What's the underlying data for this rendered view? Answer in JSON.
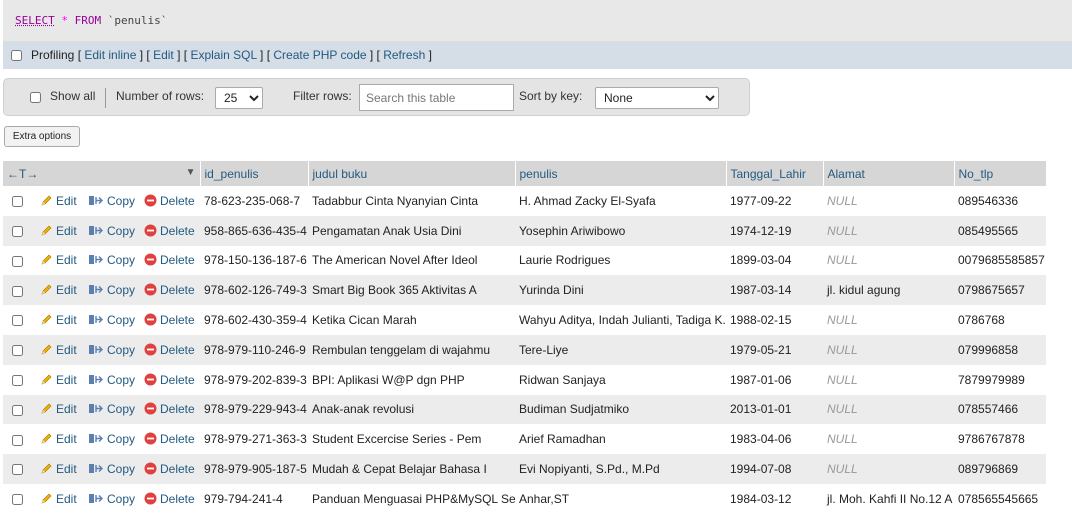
{
  "query": {
    "kw1": "SELECT",
    "star": "*",
    "kw2": "FROM",
    "table": "`penulis`"
  },
  "profiling": {
    "label": "Profiling",
    "links": [
      "Edit inline",
      "Edit",
      "Explain SQL",
      "Create PHP code",
      "Refresh"
    ]
  },
  "nav": {
    "show_all": "Show all",
    "num_rows_label": "Number of rows:",
    "num_rows_value": "25",
    "filter_label": "Filter rows:",
    "filter_placeholder": "Search this table",
    "sort_label": "Sort by key:",
    "sort_value": "None"
  },
  "extra_options": "Extra options",
  "columns": [
    "id_penulis",
    "judul buku",
    "penulis",
    "Tanggal_Lahir",
    "Alamat",
    "No_tlp"
  ],
  "header_arrows": "←T→",
  "actions": {
    "edit": "Edit",
    "copy": "Copy",
    "delete": "Delete"
  },
  "rows": [
    [
      "78-623-235-068-7",
      "Tadabbur Cinta Nyanyian Cinta",
      "H. Ahmad Zacky El-Syafa",
      "1977-09-22",
      "NULL",
      "089546336"
    ],
    [
      "958-865-636-435-4",
      "Pengamatan Anak Usia Dini",
      "Yosephin Ariwibowo",
      "1974-12-19",
      "NULL",
      "085495565"
    ],
    [
      "978-150-136-187-6",
      "The American Novel After Ideol",
      "Laurie Rodrigues",
      "1899-03-04",
      "NULL",
      "0079685585857"
    ],
    [
      "978-602-126-749-3",
      "Smart Big Book 365 Aktivitas A",
      "Yurinda Dini",
      "1987-03-14",
      "jl. kidul agung",
      "0798675657"
    ],
    [
      "978-602-430-359-4",
      "Ketika Cican Marah",
      "Wahyu Aditya, Indah Julianti, Tadiga K.",
      "1988-02-15",
      "NULL",
      "0786768"
    ],
    [
      "978-979-110-246-9",
      "Rembulan tenggelam di wajahmu",
      "Tere-Liye",
      "1979-05-21",
      "NULL",
      "079996858"
    ],
    [
      "978-979-202-839-3",
      "BPI: Aplikasi W@P dgn PHP",
      "Ridwan Sanjaya",
      "1987-01-06",
      "NULL",
      "7879979989"
    ],
    [
      "978-979-229-943-4",
      "Anak-anak revolusi",
      "Budiman Sudjatmiko",
      "2013-01-01",
      "NULL",
      "078557466"
    ],
    [
      "978-979-271-363-3",
      "Student Excercise Series - Pem",
      "Arief Ramadhan",
      "1983-04-06",
      "NULL",
      "9786767878"
    ],
    [
      "978-979-905-187-5",
      "Mudah & Cepat Belajar Bahasa I",
      "Evi Nopiyanti, S.Pd., M.Pd",
      "1994-07-08",
      "NULL",
      "089796869"
    ],
    [
      "979-794-241-4",
      "Panduan Menguasai PHP&MySQL Se",
      "Anhar,ST",
      "1984-03-12",
      "jl. Moh. Kahfi II No.12 A",
      "078565545665"
    ]
  ]
}
